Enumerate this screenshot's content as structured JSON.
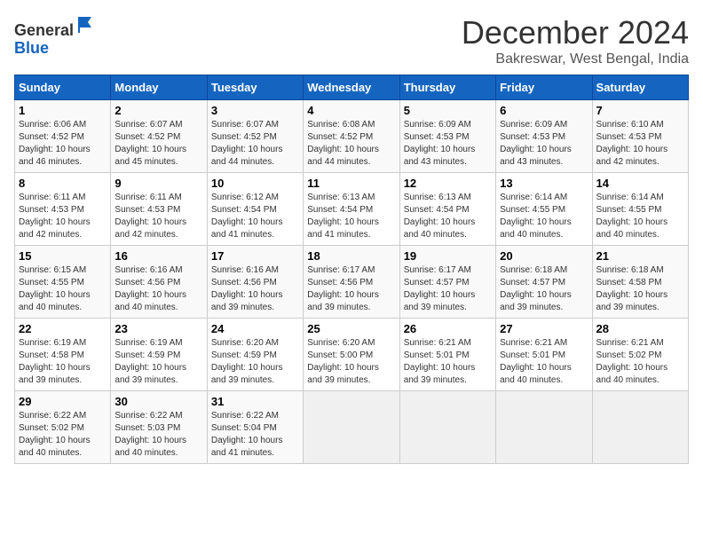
{
  "header": {
    "logo_general": "General",
    "logo_blue": "Blue",
    "title": "December 2024",
    "subtitle": "Bakreswar, West Bengal, India"
  },
  "weekdays": [
    "Sunday",
    "Monday",
    "Tuesday",
    "Wednesday",
    "Thursday",
    "Friday",
    "Saturday"
  ],
  "weeks": [
    [
      {
        "day": "1",
        "sunrise": "Sunrise: 6:06 AM",
        "sunset": "Sunset: 4:52 PM",
        "daylight": "Daylight: 10 hours and 46 minutes."
      },
      {
        "day": "2",
        "sunrise": "Sunrise: 6:07 AM",
        "sunset": "Sunset: 4:52 PM",
        "daylight": "Daylight: 10 hours and 45 minutes."
      },
      {
        "day": "3",
        "sunrise": "Sunrise: 6:07 AM",
        "sunset": "Sunset: 4:52 PM",
        "daylight": "Daylight: 10 hours and 44 minutes."
      },
      {
        "day": "4",
        "sunrise": "Sunrise: 6:08 AM",
        "sunset": "Sunset: 4:52 PM",
        "daylight": "Daylight: 10 hours and 44 minutes."
      },
      {
        "day": "5",
        "sunrise": "Sunrise: 6:09 AM",
        "sunset": "Sunset: 4:53 PM",
        "daylight": "Daylight: 10 hours and 43 minutes."
      },
      {
        "day": "6",
        "sunrise": "Sunrise: 6:09 AM",
        "sunset": "Sunset: 4:53 PM",
        "daylight": "Daylight: 10 hours and 43 minutes."
      },
      {
        "day": "7",
        "sunrise": "Sunrise: 6:10 AM",
        "sunset": "Sunset: 4:53 PM",
        "daylight": "Daylight: 10 hours and 42 minutes."
      }
    ],
    [
      {
        "day": "8",
        "sunrise": "Sunrise: 6:11 AM",
        "sunset": "Sunset: 4:53 PM",
        "daylight": "Daylight: 10 hours and 42 minutes."
      },
      {
        "day": "9",
        "sunrise": "Sunrise: 6:11 AM",
        "sunset": "Sunset: 4:53 PM",
        "daylight": "Daylight: 10 hours and 42 minutes."
      },
      {
        "day": "10",
        "sunrise": "Sunrise: 6:12 AM",
        "sunset": "Sunset: 4:54 PM",
        "daylight": "Daylight: 10 hours and 41 minutes."
      },
      {
        "day": "11",
        "sunrise": "Sunrise: 6:13 AM",
        "sunset": "Sunset: 4:54 PM",
        "daylight": "Daylight: 10 hours and 41 minutes."
      },
      {
        "day": "12",
        "sunrise": "Sunrise: 6:13 AM",
        "sunset": "Sunset: 4:54 PM",
        "daylight": "Daylight: 10 hours and 40 minutes."
      },
      {
        "day": "13",
        "sunrise": "Sunrise: 6:14 AM",
        "sunset": "Sunset: 4:55 PM",
        "daylight": "Daylight: 10 hours and 40 minutes."
      },
      {
        "day": "14",
        "sunrise": "Sunrise: 6:14 AM",
        "sunset": "Sunset: 4:55 PM",
        "daylight": "Daylight: 10 hours and 40 minutes."
      }
    ],
    [
      {
        "day": "15",
        "sunrise": "Sunrise: 6:15 AM",
        "sunset": "Sunset: 4:55 PM",
        "daylight": "Daylight: 10 hours and 40 minutes."
      },
      {
        "day": "16",
        "sunrise": "Sunrise: 6:16 AM",
        "sunset": "Sunset: 4:56 PM",
        "daylight": "Daylight: 10 hours and 40 minutes."
      },
      {
        "day": "17",
        "sunrise": "Sunrise: 6:16 AM",
        "sunset": "Sunset: 4:56 PM",
        "daylight": "Daylight: 10 hours and 39 minutes."
      },
      {
        "day": "18",
        "sunrise": "Sunrise: 6:17 AM",
        "sunset": "Sunset: 4:56 PM",
        "daylight": "Daylight: 10 hours and 39 minutes."
      },
      {
        "day": "19",
        "sunrise": "Sunrise: 6:17 AM",
        "sunset": "Sunset: 4:57 PM",
        "daylight": "Daylight: 10 hours and 39 minutes."
      },
      {
        "day": "20",
        "sunrise": "Sunrise: 6:18 AM",
        "sunset": "Sunset: 4:57 PM",
        "daylight": "Daylight: 10 hours and 39 minutes."
      },
      {
        "day": "21",
        "sunrise": "Sunrise: 6:18 AM",
        "sunset": "Sunset: 4:58 PM",
        "daylight": "Daylight: 10 hours and 39 minutes."
      }
    ],
    [
      {
        "day": "22",
        "sunrise": "Sunrise: 6:19 AM",
        "sunset": "Sunset: 4:58 PM",
        "daylight": "Daylight: 10 hours and 39 minutes."
      },
      {
        "day": "23",
        "sunrise": "Sunrise: 6:19 AM",
        "sunset": "Sunset: 4:59 PM",
        "daylight": "Daylight: 10 hours and 39 minutes."
      },
      {
        "day": "24",
        "sunrise": "Sunrise: 6:20 AM",
        "sunset": "Sunset: 4:59 PM",
        "daylight": "Daylight: 10 hours and 39 minutes."
      },
      {
        "day": "25",
        "sunrise": "Sunrise: 6:20 AM",
        "sunset": "Sunset: 5:00 PM",
        "daylight": "Daylight: 10 hours and 39 minutes."
      },
      {
        "day": "26",
        "sunrise": "Sunrise: 6:21 AM",
        "sunset": "Sunset: 5:01 PM",
        "daylight": "Daylight: 10 hours and 39 minutes."
      },
      {
        "day": "27",
        "sunrise": "Sunrise: 6:21 AM",
        "sunset": "Sunset: 5:01 PM",
        "daylight": "Daylight: 10 hours and 40 minutes."
      },
      {
        "day": "28",
        "sunrise": "Sunrise: 6:21 AM",
        "sunset": "Sunset: 5:02 PM",
        "daylight": "Daylight: 10 hours and 40 minutes."
      }
    ],
    [
      {
        "day": "29",
        "sunrise": "Sunrise: 6:22 AM",
        "sunset": "Sunset: 5:02 PM",
        "daylight": "Daylight: 10 hours and 40 minutes."
      },
      {
        "day": "30",
        "sunrise": "Sunrise: 6:22 AM",
        "sunset": "Sunset: 5:03 PM",
        "daylight": "Daylight: 10 hours and 40 minutes."
      },
      {
        "day": "31",
        "sunrise": "Sunrise: 6:22 AM",
        "sunset": "Sunset: 5:04 PM",
        "daylight": "Daylight: 10 hours and 41 minutes."
      },
      null,
      null,
      null,
      null
    ]
  ]
}
